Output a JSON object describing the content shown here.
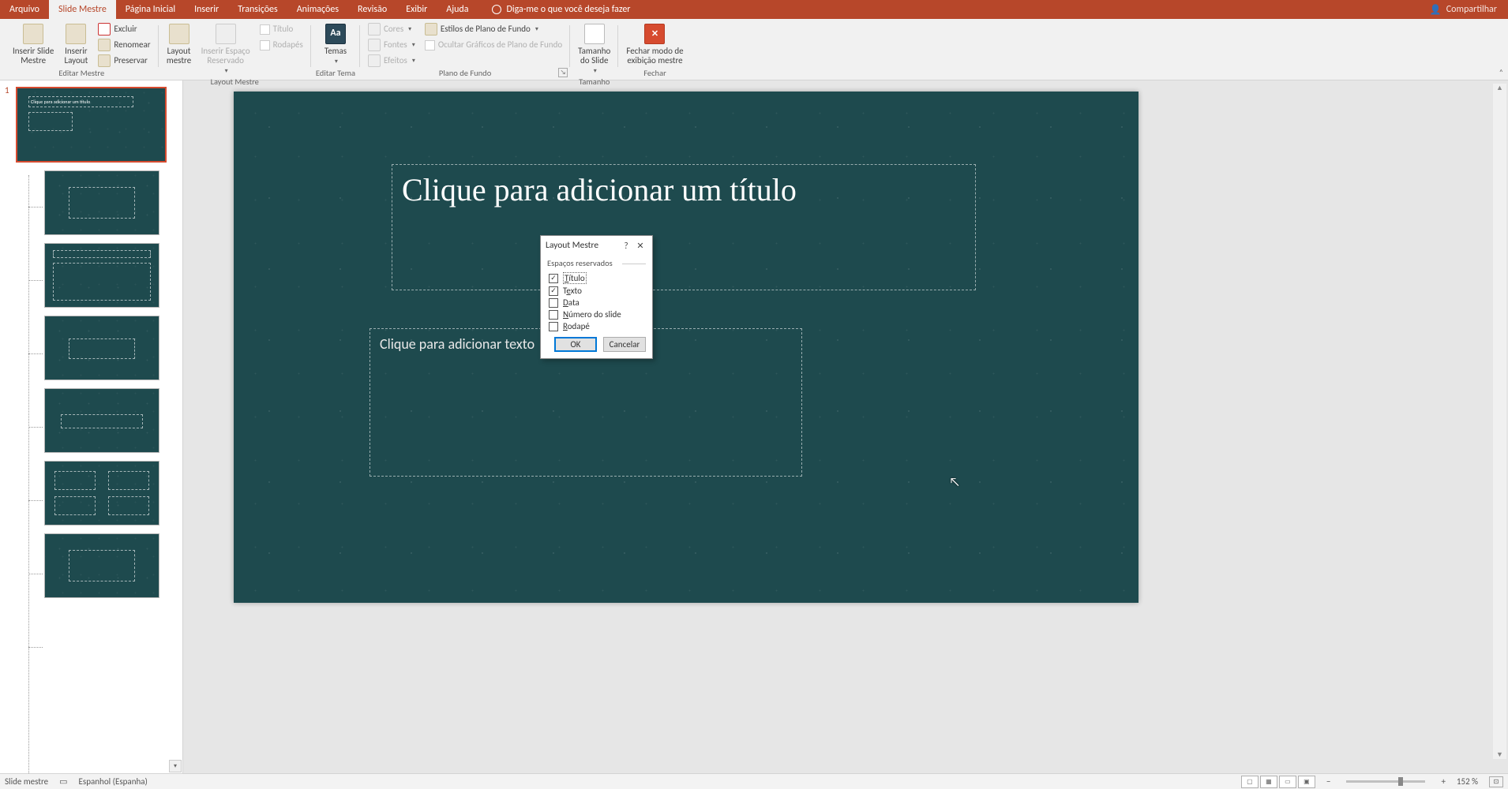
{
  "tabs": {
    "arquivo": "Arquivo",
    "slide_mestre": "Slide Mestre",
    "pagina_inicial": "Página Inicial",
    "inserir": "Inserir",
    "transicoes": "Transições",
    "animacoes": "Animações",
    "revisao": "Revisão",
    "exibir": "Exibir",
    "ajuda": "Ajuda",
    "tell_me": "Diga-me o que você deseja fazer",
    "share": "Compartilhar"
  },
  "ribbon": {
    "editar_mestre": {
      "label": "Editar Mestre",
      "inserir_slide_mestre": "Inserir Slide\nMestre",
      "inserir_layout": "Inserir\nLayout",
      "excluir": "Excluir",
      "renomear": "Renomear",
      "preservar": "Preservar"
    },
    "layout_mestre": {
      "label": "Layout Mestre",
      "layout_mestre_btn": "Layout\nmestre",
      "inserir_espaco": "Inserir Espaço\nReservado",
      "titulo": "Título",
      "rodapes": "Rodapés"
    },
    "editar_tema": {
      "label": "Editar Tema",
      "temas": "Temas"
    },
    "plano_fundo": {
      "label": "Plano de Fundo",
      "cores": "Cores",
      "fontes": "Fontes",
      "efeitos": "Efeitos",
      "estilos": "Estilos de Plano de Fundo",
      "ocultar": "Ocultar Gráficos de Plano de Fundo"
    },
    "tamanho": {
      "label": "Tamanho",
      "btn": "Tamanho\ndo Slide"
    },
    "fechar": {
      "label": "Fechar",
      "btn": "Fechar modo de\nexibição mestre"
    }
  },
  "slide": {
    "title_placeholder": "Clique para adicionar um título",
    "body_placeholder": "Clique para adicionar texto"
  },
  "thumb": {
    "num": "1",
    "mini_title": "Clique para adicionar um título"
  },
  "dialog": {
    "title": "Layout Mestre",
    "section": "Espaços reservados",
    "titulo": "Título",
    "texto": "Texto",
    "data": "Data",
    "numero": "Número do slide",
    "rodape": "Rodapé",
    "ok": "OK",
    "cancel": "Cancelar"
  },
  "status": {
    "mode": "Slide mestre",
    "lang": "Espanhol (Espanha)",
    "zoom": "152 %"
  }
}
